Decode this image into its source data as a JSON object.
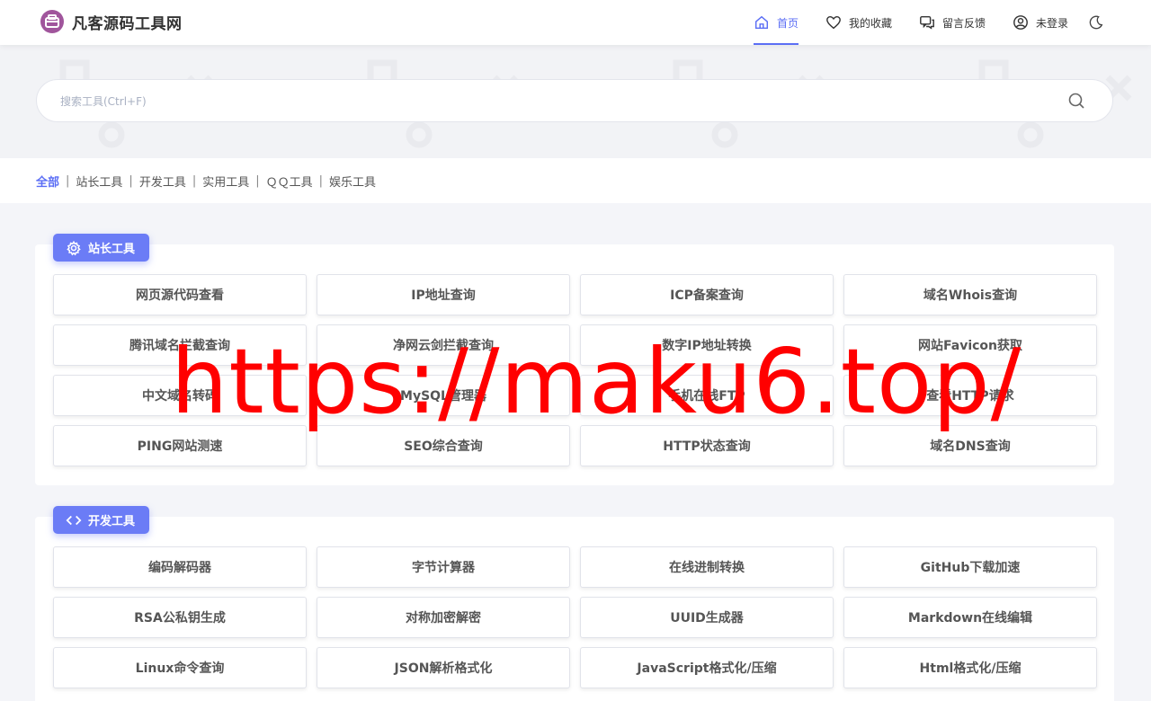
{
  "brand": {
    "name": "凡客源码工具网",
    "accent": "#5b6ef5",
    "logo_color": "#a0559c"
  },
  "nav": [
    {
      "label": "首页",
      "icon": "home-icon",
      "active": true
    },
    {
      "label": "我的收藏",
      "icon": "heart-icon",
      "active": false
    },
    {
      "label": "留言反馈",
      "icon": "message-icon",
      "active": false
    },
    {
      "label": "未登录",
      "icon": "user-icon",
      "active": false
    }
  ],
  "theme_toggle_icon": "moon-icon",
  "search": {
    "placeholder": "搜索工具(Ctrl+F)",
    "value": "",
    "icon": "search-icon"
  },
  "filters": [
    {
      "label": "全部",
      "active": true
    },
    {
      "label": "站长工具",
      "active": false
    },
    {
      "label": "开发工具",
      "active": false
    },
    {
      "label": "实用工具",
      "active": false
    },
    {
      "label": "ＱＱ工具",
      "active": false
    },
    {
      "label": "娱乐工具",
      "active": false
    }
  ],
  "sections": [
    {
      "title": "站长工具",
      "icon": "gear-icon",
      "tools": [
        "网页源代码查看",
        "IP地址查询",
        "ICP备案查询",
        "域名Whois查询",
        "腾讯域名拦截查询",
        "净网云剑拦截查询",
        "数字IP地址转换",
        "网站Favicon获取",
        "中文域名转码",
        "MySQL管理器",
        "手机在线FTP",
        "查看HTTP请求",
        "PING网站测速",
        "SEO综合查询",
        "HTTP状态查询",
        "域名DNS查询"
      ]
    },
    {
      "title": "开发工具",
      "icon": "code-icon",
      "tools": [
        "编码解码器",
        "字节计算器",
        "在线进制转换",
        "GitHub下载加速",
        "RSA公私钥生成",
        "对称加密解密",
        "UUID生成器",
        "Markdown在线编辑",
        "Linux命令查询",
        "JSON解析格式化",
        "JavaScript格式化/压缩",
        "Html格式化/压缩"
      ]
    }
  ],
  "watermark": "https://maku6.top/"
}
